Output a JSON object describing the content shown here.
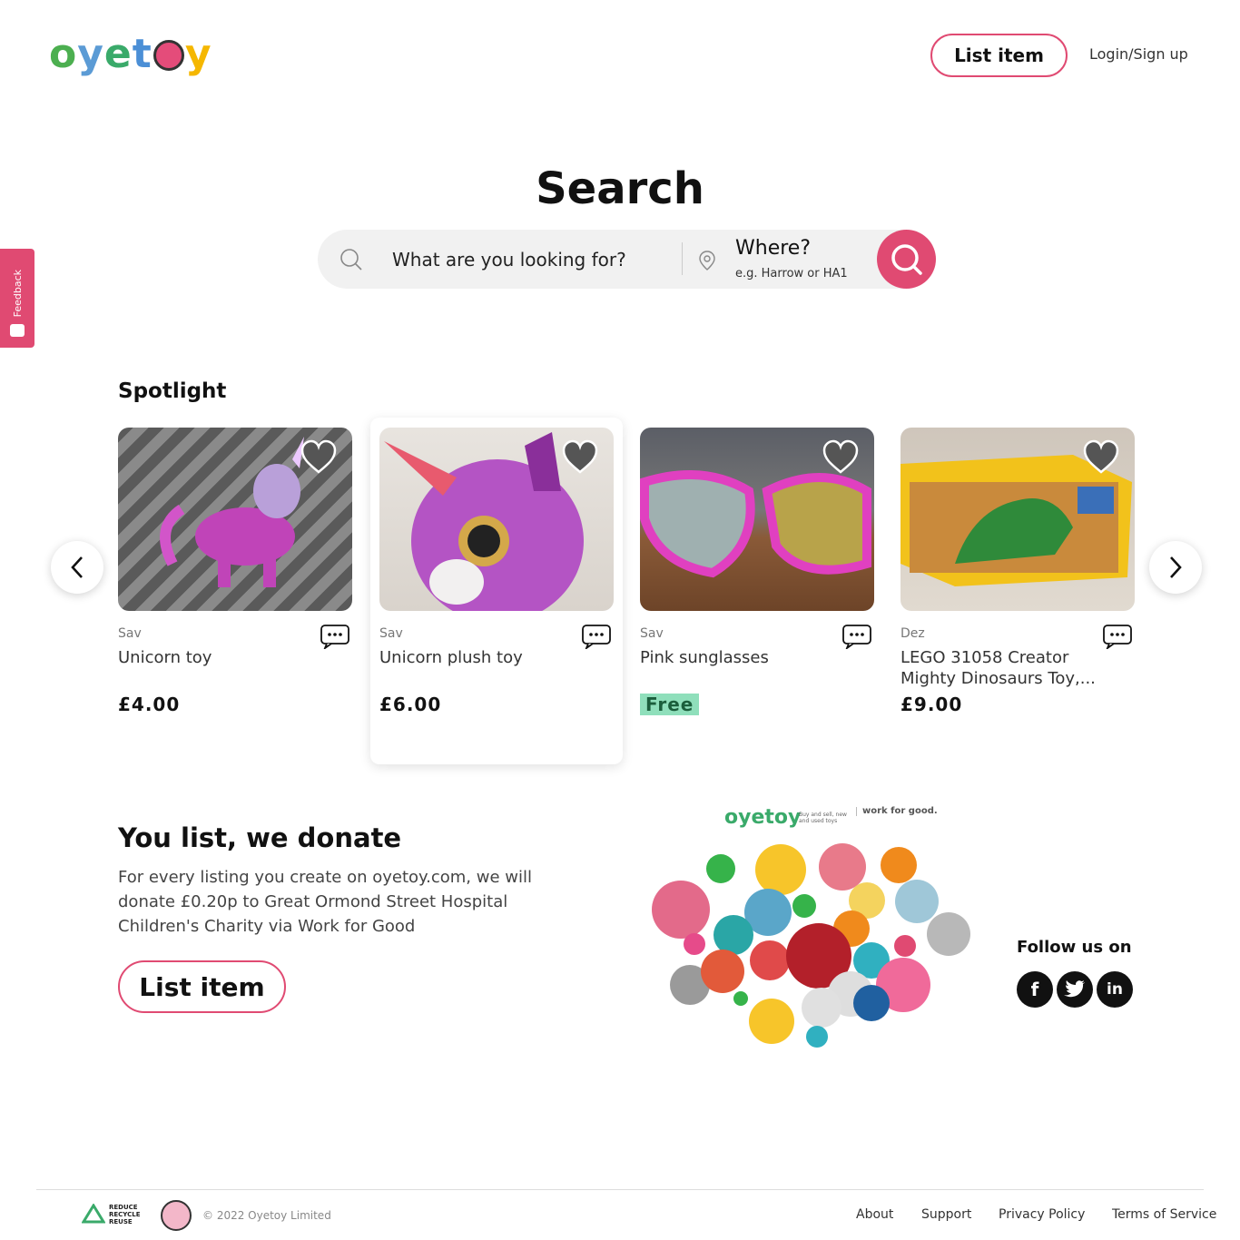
{
  "header": {
    "logo_letters": [
      "o",
      "y",
      "e",
      "t",
      "o",
      "y"
    ],
    "logo_colors": [
      "#4caf50",
      "#5b9bd5",
      "#3aaa6a",
      "#4b8fd6",
      "#e44c7a",
      "#f5b700"
    ],
    "list_item_label": "List item",
    "login_label": "Login/Sign up"
  },
  "feedback": {
    "label": "Feedback"
  },
  "search": {
    "title": "Search",
    "what_placeholder": "What are you looking for?",
    "where_label": "Where?",
    "where_placeholder": "e.g. Harrow or HA1"
  },
  "spotlight": {
    "title": "Spotlight",
    "items": [
      {
        "seller": "Sav",
        "title": "Unicorn toy",
        "price": "£4.00"
      },
      {
        "seller": "Sav",
        "title": "Unicorn plush toy",
        "price": "£6.00"
      },
      {
        "seller": "Sav",
        "title": "Pink sunglasses",
        "price": "Free"
      },
      {
        "seller": "Dez",
        "title": "LEGO 31058 Creator Mighty Dinosaurs Toy,...",
        "price": "£9.00"
      }
    ]
  },
  "donate": {
    "title": "You list, we donate",
    "text": "For every listing you create on oyetoy.com, we will donate £0.20p to Great Ormond Street Hospital Children's Charity via Work for Good",
    "button_label": "List item"
  },
  "collage": {
    "logo": "oyetoy",
    "tagline": "Buy and sell, new and used toys",
    "partner": "work for good."
  },
  "follow": {
    "title": "Follow us on",
    "networks": [
      "facebook-icon",
      "twitter-icon",
      "linkedin-icon"
    ]
  },
  "footer": {
    "recycle_text": [
      "REDUCE",
      "RECYCLE",
      "REUSE"
    ],
    "copyright": "© 2022 Oyetoy Limited",
    "links": [
      "About",
      "Support",
      "Privacy Policy",
      "Terms of Service"
    ]
  },
  "colors": {
    "accent": "#e04a72",
    "free_badge": "#8fdfbb"
  }
}
